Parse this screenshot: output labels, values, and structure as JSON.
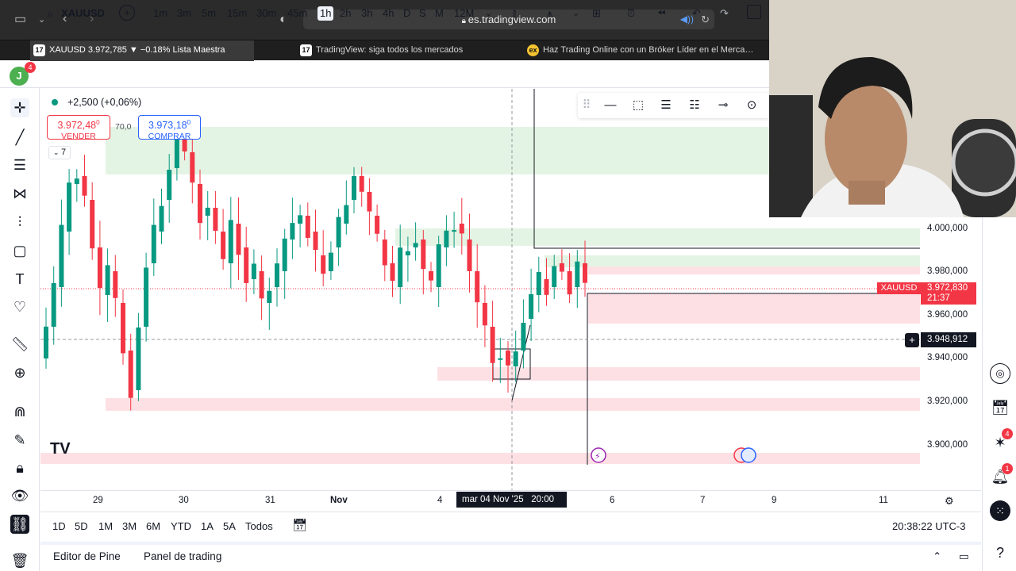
{
  "browser": {
    "url": "es.tradingview.com",
    "tabs": [
      {
        "label": "XAUUSD 3.972,785 ▼ −0.18% Lista Maestra",
        "icon": "tradingview-icon"
      },
      {
        "label": "TradingView: siga todos los mercados",
        "icon": "tradingview-icon"
      },
      {
        "label": "Haz Trading Online con un Bróker Líder en el Merca…",
        "icon": "broker-icon"
      }
    ]
  },
  "toolbar": {
    "avatar_letter": "J",
    "avatar_badge": "4",
    "symbol": "XAUUSD",
    "intervals": [
      "1m",
      "3m",
      "5m",
      "15m",
      "30m",
      "45m",
      "1h",
      "2h",
      "3h",
      "4h",
      "D",
      "S",
      "M",
      "12M"
    ],
    "selected_interval": "1h"
  },
  "legend": {
    "change": "+2,500 (+0,06%)",
    "sell_price": "3.972,48",
    "sell_price_sup": "0",
    "sell_label": "VENDER",
    "spread": "70,0",
    "buy_price": "3.973,18",
    "buy_price_sup": "0",
    "buy_label": "COMPRAR",
    "indicators_count": "7"
  },
  "price_axis": {
    "ticks": [
      "4.000,000",
      "3.980,000",
      "3.960,000",
      "3.940,000",
      "3.920,000",
      "3.900,000"
    ],
    "symbol_label": "XAUUSD",
    "last_price": "3.972,830",
    "countdown": "21:37",
    "crosshair_price": "3.948,912"
  },
  "time_axis": {
    "ticks": [
      "29",
      "30",
      "31",
      "Nov",
      "4",
      "6",
      "7",
      "9",
      "11"
    ],
    "crosshair_label": "mar 04 Nov '25   20:00"
  },
  "range_bar": {
    "ranges": [
      "1D",
      "5D",
      "1M",
      "3M",
      "6M",
      "YTD",
      "1A",
      "5A",
      "Todos"
    ],
    "clock": "20:38:22 UTC-3"
  },
  "bottom_bar": {
    "pine_editor": "Editor de Pine",
    "trading_panel": "Panel de trading"
  },
  "right_rail": {
    "badge_1": "4",
    "badge_2": "1"
  },
  "colors": {
    "bull": "#089981",
    "bear": "#f23645",
    "demand_zone": "#e4f4e4",
    "supply_zone": "#fde0e4",
    "accent": "#2962ff"
  }
}
